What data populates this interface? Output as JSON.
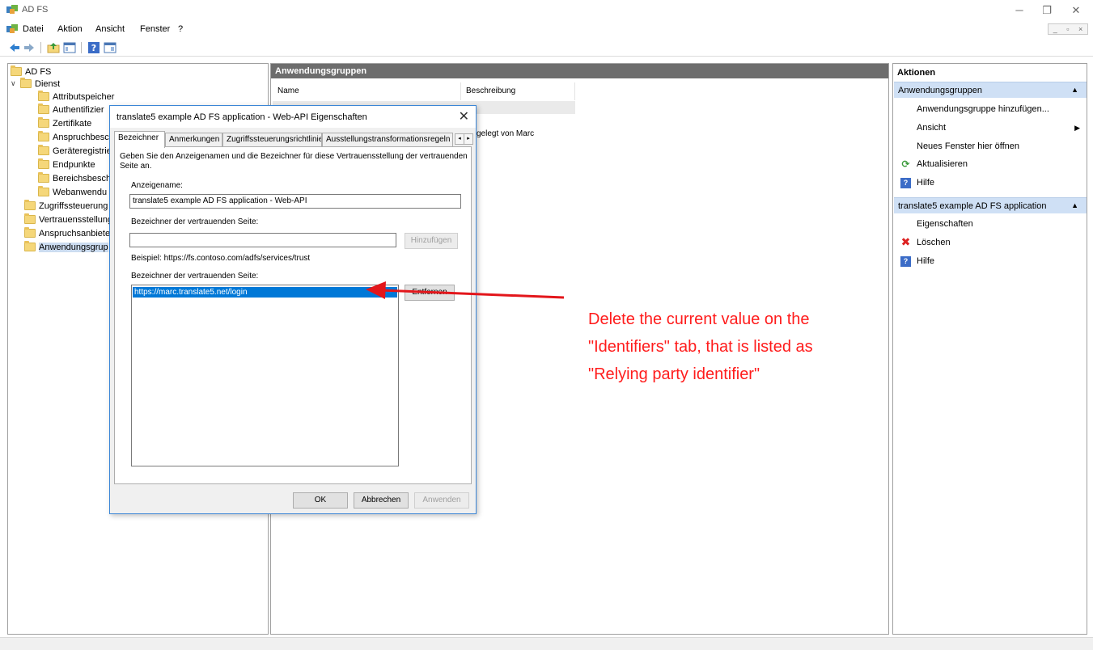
{
  "window": {
    "title": "AD FS",
    "controls": {
      "minimize": "─",
      "restore": "❐",
      "close": "✕"
    },
    "mdi_controls": [
      "_",
      "▫",
      "×"
    ]
  },
  "menu": [
    "Datei",
    "Aktion",
    "Ansicht",
    "Fenster",
    "?"
  ],
  "tree": {
    "root": "AD FS",
    "service": "Dienst",
    "service_children": [
      "Attributspeicher",
      "Authentifizier",
      "Zertifikate",
      "Anspruchbesc",
      "Geräteregistrie",
      "Endpunkte",
      "Bereichsbesch",
      "Webanwendu"
    ],
    "others": [
      "Zugriffssteuerung",
      "Vertrauensstellung",
      "Anspruchsanbiete",
      "Anwendungsgrup"
    ]
  },
  "middle": {
    "header": "Anwendungsgruppen",
    "columns": [
      "Name",
      "Beschreibung"
    ],
    "visible_text": "gelegt von Marc"
  },
  "actions": {
    "title": "Aktionen",
    "section1": {
      "title": "Anwendungsgruppen",
      "items": [
        "Anwendungsgruppe hinzufügen...",
        "Ansicht",
        "Neues Fenster hier öffnen",
        "Aktualisieren",
        "Hilfe"
      ]
    },
    "section2": {
      "title": "translate5 example AD FS application",
      "items": [
        "Eigenschaften",
        "Löschen",
        "Hilfe"
      ]
    }
  },
  "dialog": {
    "title": "translate5 example AD FS application - Web-API Eigenschaften",
    "close": "✕",
    "tabs": [
      "Bezeichner",
      "Anmerkungen",
      "Zugriffssteuerungsrichtlinie",
      "Ausstellungstransformationsregeln"
    ],
    "tab_scroll": [
      "◂",
      "▸"
    ],
    "intro": [
      "Geben Sie den Anzeigenamen und die Bezeichner für diese Vertrauensstellung der vertrauenden",
      "Seite an."
    ],
    "display_name_label": "Anzeigename:",
    "display_name_value": "translate5 example AD FS application - Web-API",
    "identifier_label": "Bezeichner der vertrauenden Seite:",
    "identifier_value": "",
    "add_button": "Hinzufügen",
    "example": "Beispiel: https://fs.contoso.com/adfs/services/trust",
    "list_label": "Bezeichner der vertrauenden Seite:",
    "list_items": [
      "https://marc.translate5.net/login"
    ],
    "remove_button": "Entfernen",
    "ok_button": "OK",
    "cancel_button": "Abbrechen",
    "apply_button": "Anwenden"
  },
  "annotation": {
    "lines": [
      "Delete the current value on the",
      "\"Identifiers\" tab, that is listed as",
      "\"Relying party identifier\""
    ],
    "color": "#ff1c1c"
  }
}
